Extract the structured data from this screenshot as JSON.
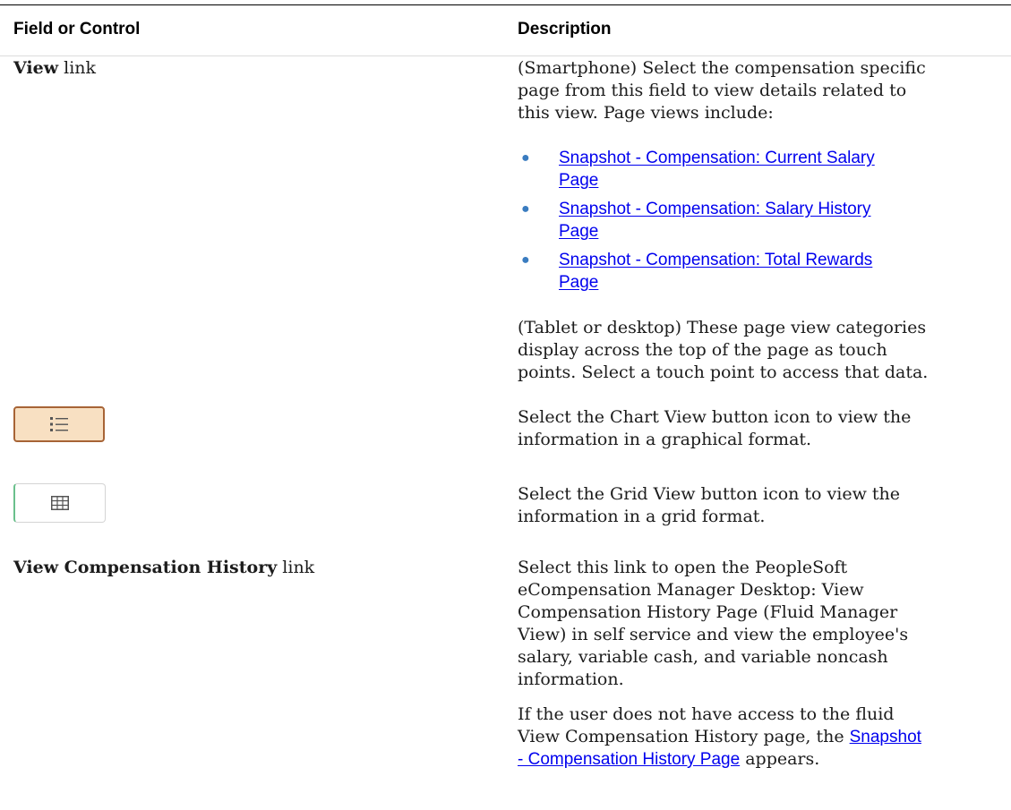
{
  "header": {
    "col1": "Field or Control",
    "col2": "Description"
  },
  "rows": {
    "view_link": {
      "label_bold": "View",
      "label_suffix": " link",
      "desc_intro": "(Smartphone) Select the compensation specific\npage from this field to view details related to\nthis view. Page views include:",
      "links": [
        "Snapshot - Compensation: Current Salary\nPage",
        "Snapshot - Compensation: Salary History\nPage",
        "Snapshot - Compensation: Total Rewards\nPage"
      ],
      "desc_after": "(Tablet or desktop) These page view categories\ndisplay across the top of the page as touch\npoints. Select a touch point to access that data."
    },
    "chart_view": {
      "icon": "list-icon",
      "desc": "Select the Chart View button icon to view the\ninformation in a graphical format."
    },
    "grid_view": {
      "icon": "grid-icon",
      "desc": "Select the Grid View button icon to view the\ninformation in a grid format."
    },
    "comp_history": {
      "label_bold": "View Compensation History",
      "label_suffix": " link",
      "desc1": "Select this link to open the PeopleSoft\neCompensation Manager Desktop: View\nCompensation History Page (Fluid Manager\nView) in self service and view the employee's\nsalary, variable cash, and variable noncash\ninformation.",
      "desc2_before": "If the user does not have access to the fluid\nView Compensation History page, the ",
      "desc2_link_line1": "Snapshot",
      "desc2_link_line2": "- Compensation History Page",
      "desc2_after": " appears."
    }
  },
  "colors": {
    "link": "#0000ee",
    "bullet": "#3a7cc0",
    "chart_button_fill": "#f8e0c2",
    "chart_button_border": "#a76436",
    "grid_button_accent": "#6ac08c"
  }
}
